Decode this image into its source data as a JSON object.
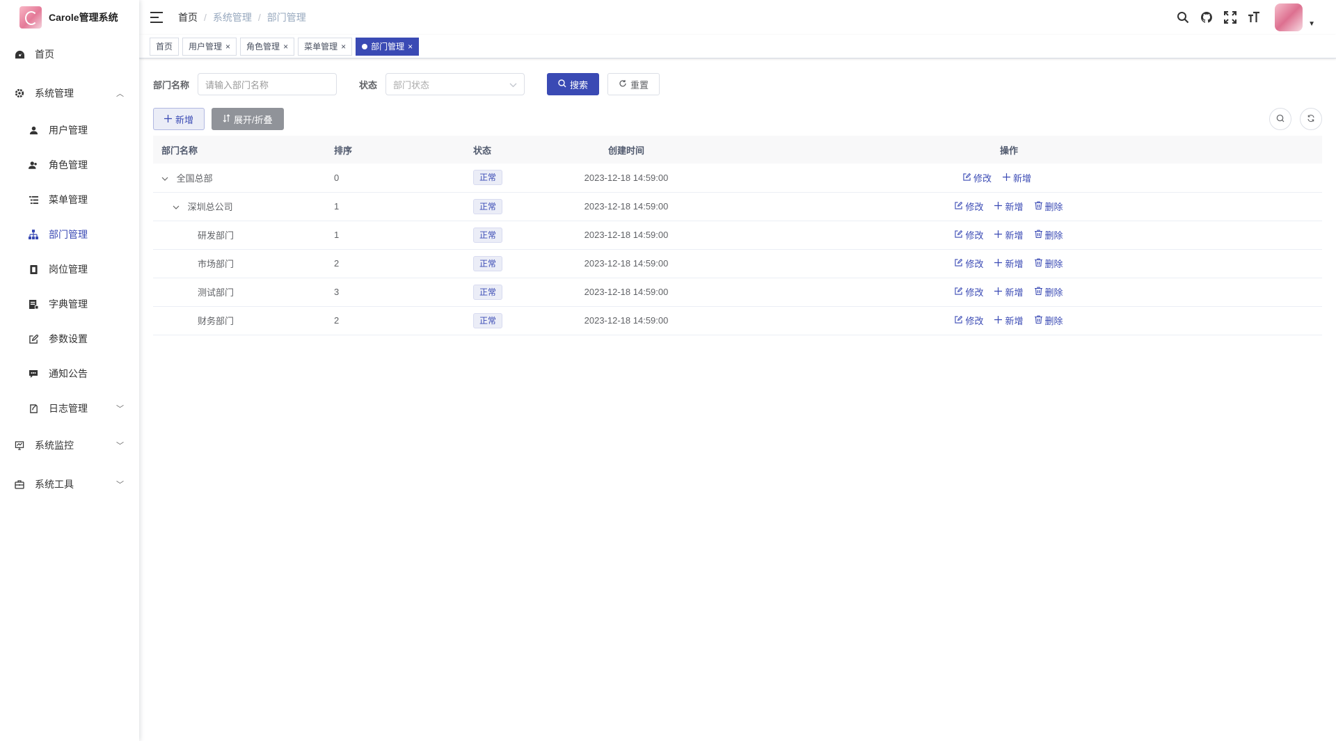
{
  "app": {
    "title": "Carole管理系统"
  },
  "sidebar": {
    "items": [
      {
        "label": "首页",
        "icon": "dashboard-icon"
      },
      {
        "label": "系统管理",
        "icon": "gear-icon",
        "arrow": "︿"
      },
      {
        "label": "用户管理",
        "icon": "user-icon"
      },
      {
        "label": "角色管理",
        "icon": "peoples-icon"
      },
      {
        "label": "菜单管理",
        "icon": "tree-table-icon"
      },
      {
        "label": "部门管理",
        "icon": "tree-icon"
      },
      {
        "label": "岗位管理",
        "icon": "post-icon"
      },
      {
        "label": "字典管理",
        "icon": "dict-icon"
      },
      {
        "label": "参数设置",
        "icon": "edit-icon"
      },
      {
        "label": "通知公告",
        "icon": "message-icon"
      },
      {
        "label": "日志管理",
        "icon": "log-icon",
        "arrow": "﹀"
      },
      {
        "label": "系统监控",
        "icon": "monitor-icon",
        "arrow": "﹀"
      },
      {
        "label": "系统工具",
        "icon": "tool-icon",
        "arrow": "﹀"
      }
    ]
  },
  "breadcrumb": {
    "home": "首页",
    "section": "系统管理",
    "page": "部门管理",
    "sep": "/"
  },
  "tags": [
    {
      "label": "首页"
    },
    {
      "label": "用户管理",
      "close": "×"
    },
    {
      "label": "角色管理",
      "close": "×"
    },
    {
      "label": "菜单管理",
      "close": "×"
    },
    {
      "label": "部门管理",
      "close": "×"
    }
  ],
  "search": {
    "dept_label": "部门名称",
    "dept_placeholder": "请输入部门名称",
    "status_label": "状态",
    "status_placeholder": "部门状态",
    "search_btn": "搜索",
    "reset_btn": "重置"
  },
  "toolbar": {
    "add_btn": "新增",
    "expand_btn": "展开/折叠"
  },
  "table": {
    "headers": {
      "name": "部门名称",
      "order": "排序",
      "status": "状态",
      "created": "创建时间",
      "ops": "操作"
    },
    "ops_labels": {
      "edit": "修改",
      "add": "新增",
      "delete": "删除"
    },
    "rows": [
      {
        "name": "全国总部",
        "order": "0",
        "status": "正常",
        "created": "2023-12-18 14:59:00"
      },
      {
        "name": "深圳总公司",
        "order": "1",
        "status": "正常",
        "created": "2023-12-18 14:59:00"
      },
      {
        "name": "研发部门",
        "order": "1",
        "status": "正常",
        "created": "2023-12-18 14:59:00"
      },
      {
        "name": "市场部门",
        "order": "2",
        "status": "正常",
        "created": "2023-12-18 14:59:00"
      },
      {
        "name": "测试部门",
        "order": "3",
        "status": "正常",
        "created": "2023-12-18 14:59:00"
      },
      {
        "name": "财务部门",
        "order": "2",
        "status": "正常",
        "created": "2023-12-18 14:59:00"
      }
    ]
  },
  "colors": {
    "primary": "#3a4ab4",
    "border": "#dcdfe6",
    "header_bg": "#f8f8f9"
  }
}
